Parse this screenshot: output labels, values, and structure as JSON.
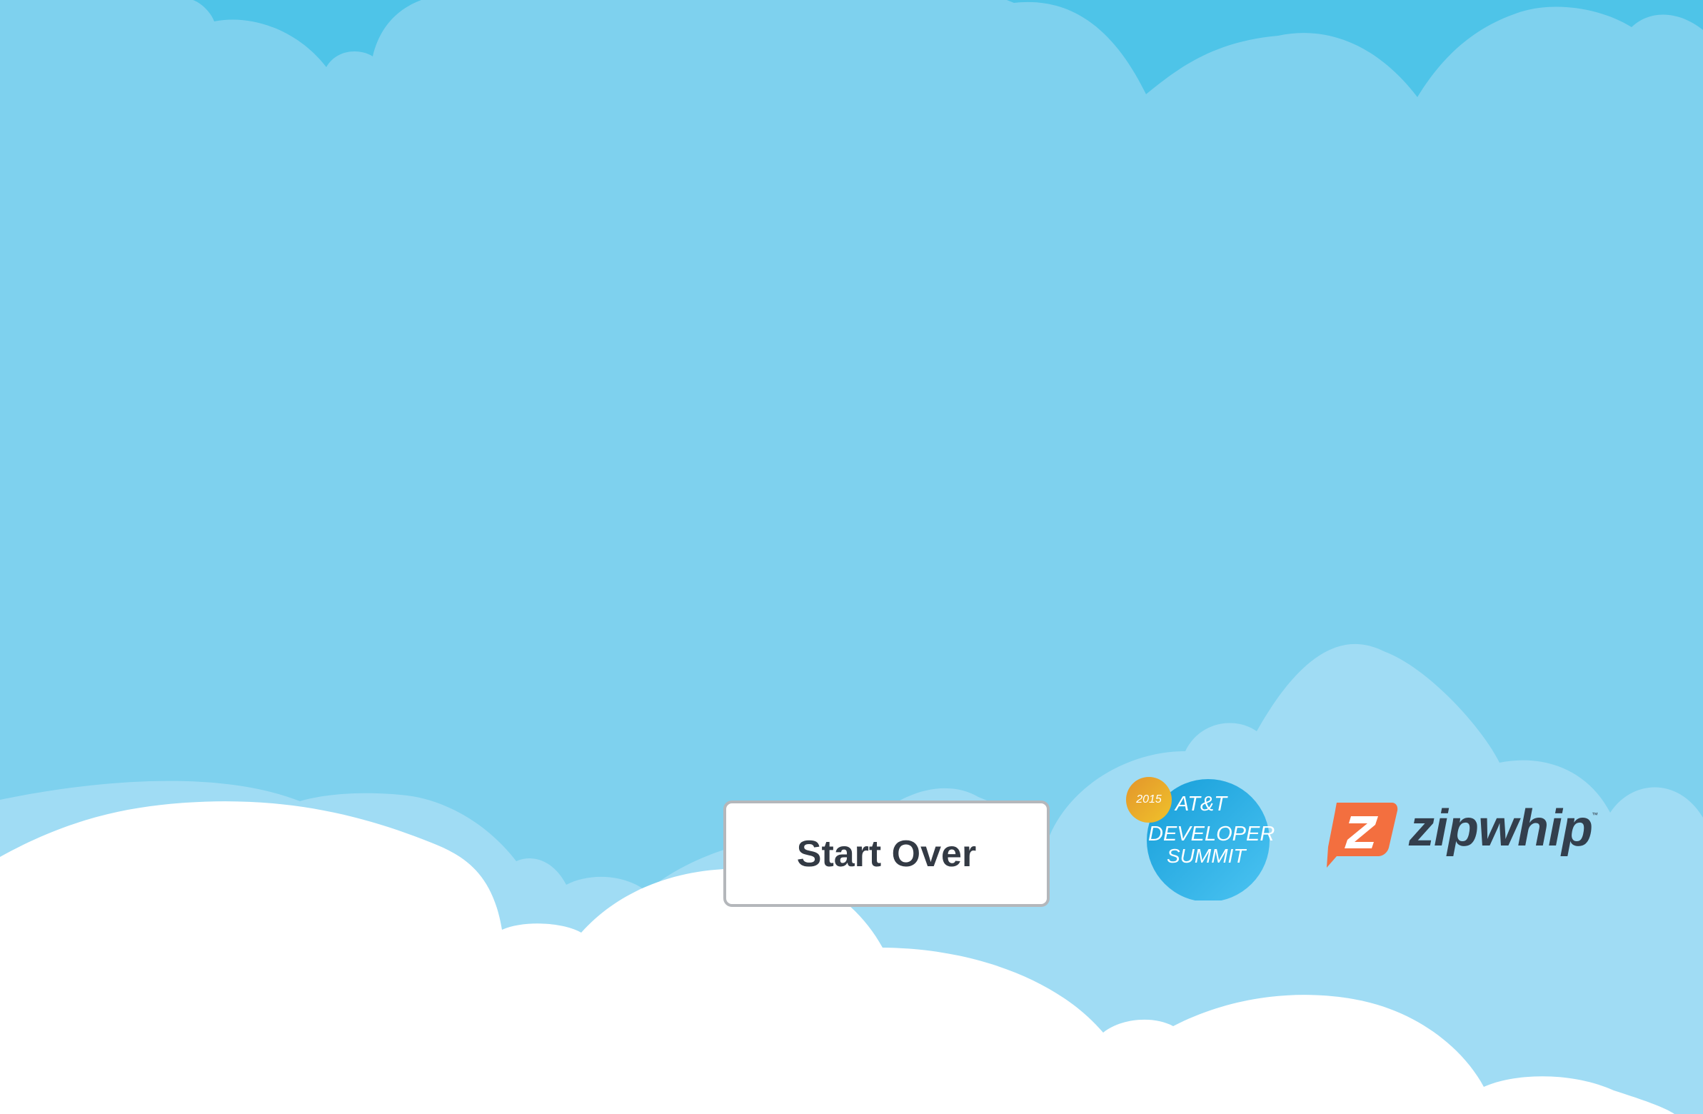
{
  "screen": {
    "start_over_label": "Start Over"
  },
  "logos": {
    "att_summit": {
      "year": "2015",
      "line1": "AT&T",
      "line2": "DEVELOPER",
      "line3": "SUMMIT"
    },
    "zipwhip": {
      "wordmark": "zipwhip",
      "trademark": "™"
    }
  },
  "colors": {
    "sky": "#7ed1ee",
    "sky_dark": "#4ec4e8",
    "cloud_light": "#a0dcf4",
    "cloud_white": "#ffffff",
    "button_border": "#b4b7bb",
    "button_text": "#333a44",
    "att_gold": "#e8a82a",
    "att_blue": "#2aa8df",
    "zipwhip_orange": "#f36f3f",
    "zipwhip_dark": "#333f4d"
  },
  "icons": {
    "clouds": "cloud-illustration",
    "zipwhip_mark": "zipwhip-z-speech-bubble"
  }
}
